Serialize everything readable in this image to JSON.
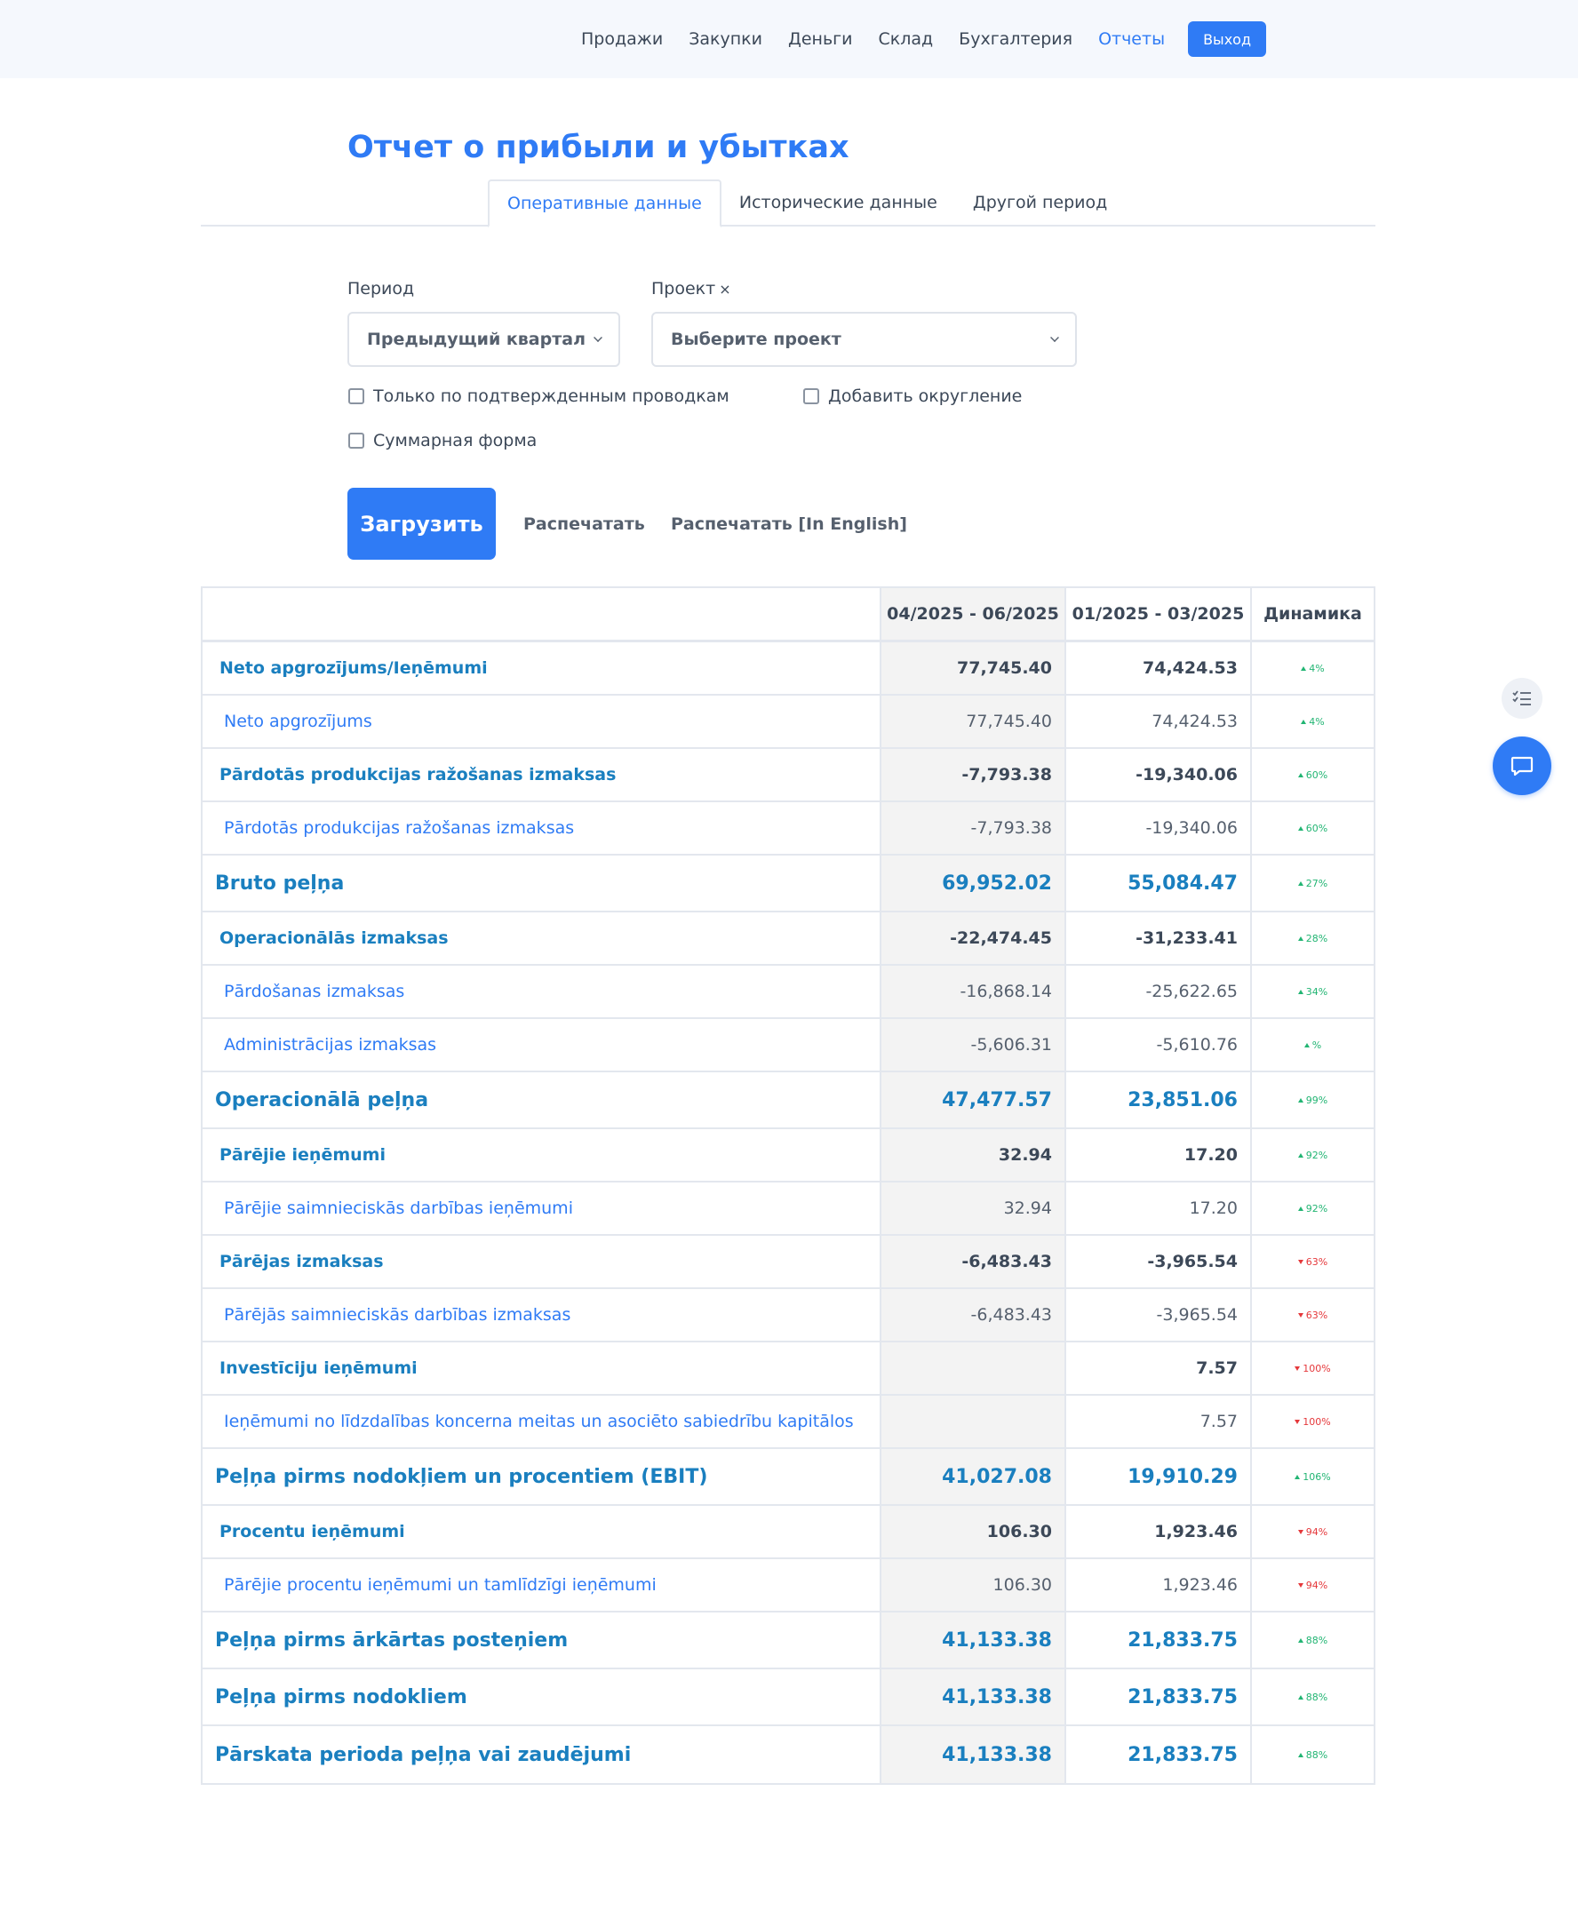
{
  "nav": {
    "items": [
      {
        "label": "Продажи",
        "active": false
      },
      {
        "label": "Закупки",
        "active": false
      },
      {
        "label": "Деньги",
        "active": false
      },
      {
        "label": "Склад",
        "active": false
      },
      {
        "label": "Бухгалтерия",
        "active": false
      },
      {
        "label": "Отчеты",
        "active": true
      }
    ],
    "logout_label": "Выход"
  },
  "page": {
    "title": "Отчет о прибыли и убытках"
  },
  "tabs": [
    {
      "label": "Оперативные данные",
      "active": true
    },
    {
      "label": "Исторические данные",
      "active": false
    },
    {
      "label": "Другой период",
      "active": false
    }
  ],
  "form": {
    "period_label": "Период",
    "period_value": "Предыдущий квартал",
    "project_label": "Проект",
    "project_clear": "×",
    "project_value": "Выберите проект",
    "checkbox_confirmed": "Только по подтвержденным проводкам",
    "checkbox_rounding": "Добавить округление",
    "checkbox_summary": "Суммарная форма",
    "load_button": "Загрузить",
    "print_button": "Распечатать",
    "print_en_button": "Распечатать [In English]"
  },
  "table": {
    "headers": [
      "",
      "04/2025 - 06/2025",
      "01/2025 - 03/2025",
      "Динамика"
    ],
    "rows": [
      {
        "type": "section",
        "label": "Neto apgrozījums/Ieņēmumi",
        "cur": "77,745.40",
        "prev": "74,424.53",
        "dyn": "4%",
        "dir": "up"
      },
      {
        "type": "item",
        "label": "Neto apgrozījums",
        "cur": "77,745.40",
        "prev": "74,424.53",
        "dyn": "4%",
        "dir": "up"
      },
      {
        "type": "section",
        "label": "Pārdotās produkcijas ražošanas izmaksas",
        "cur": "-7,793.38",
        "prev": "-19,340.06",
        "dyn": "60%",
        "dir": "up"
      },
      {
        "type": "item",
        "label": "Pārdotās produkcijas ražošanas izmaksas",
        "cur": "-7,793.38",
        "prev": "-19,340.06",
        "dyn": "60%",
        "dir": "up"
      },
      {
        "type": "total",
        "label": "Bruto peļņa",
        "cur": "69,952.02",
        "prev": "55,084.47",
        "dyn": "27%",
        "dir": "up"
      },
      {
        "type": "section",
        "label": "Operacionālās izmaksas",
        "cur": "-22,474.45",
        "prev": "-31,233.41",
        "dyn": "28%",
        "dir": "up"
      },
      {
        "type": "item",
        "label": "Pārdošanas izmaksas",
        "cur": "-16,868.14",
        "prev": "-25,622.65",
        "dyn": "34%",
        "dir": "up"
      },
      {
        "type": "item",
        "label": "Administrācijas izmaksas",
        "cur": "-5,606.31",
        "prev": "-5,610.76",
        "dyn": "%",
        "dir": "up"
      },
      {
        "type": "total",
        "label": "Operacionālā peļņa",
        "cur": "47,477.57",
        "prev": "23,851.06",
        "dyn": "99%",
        "dir": "up"
      },
      {
        "type": "section",
        "label": "Pārējie ieņēmumi",
        "cur": "32.94",
        "prev": "17.20",
        "dyn": "92%",
        "dir": "up"
      },
      {
        "type": "item",
        "label": "Pārējie saimnieciskās darbības ieņēmumi",
        "cur": "32.94",
        "prev": "17.20",
        "dyn": "92%",
        "dir": "up"
      },
      {
        "type": "section",
        "label": "Pārējas izmaksas",
        "cur": "-6,483.43",
        "prev": "-3,965.54",
        "dyn": "63%",
        "dir": "down"
      },
      {
        "type": "item",
        "label": "Pārējās saimnieciskās darbības izmaksas",
        "cur": "-6,483.43",
        "prev": "-3,965.54",
        "dyn": "63%",
        "dir": "down"
      },
      {
        "type": "section",
        "label": "Investīciju ieņēmumi",
        "cur": "",
        "prev": "7.57",
        "dyn": "100%",
        "dir": "down"
      },
      {
        "type": "item",
        "label": "Ieņēmumi no līdzdalības koncerna meitas un asociēto sabiedrību kapitālos",
        "cur": "",
        "prev": "7.57",
        "dyn": "100%",
        "dir": "down"
      },
      {
        "type": "total",
        "label": "Peļņa pirms nodokļiem un procentiem (EBIT)",
        "cur": "41,027.08",
        "prev": "19,910.29",
        "dyn": "106%",
        "dir": "up"
      },
      {
        "type": "section",
        "label": "Procentu ieņēmumi",
        "cur": "106.30",
        "prev": "1,923.46",
        "dyn": "94%",
        "dir": "down"
      },
      {
        "type": "item",
        "label": "Pārējie procentu ieņēmumi un tamlīdzīgi ieņēmumi",
        "cur": "106.30",
        "prev": "1,923.46",
        "dyn": "94%",
        "dir": "down"
      },
      {
        "type": "total",
        "label": "Peļņa pirms ārkārtas posteņiem",
        "cur": "41,133.38",
        "prev": "21,833.75",
        "dyn": "88%",
        "dir": "up"
      },
      {
        "type": "total",
        "label": "Peļņa pirms nodokliem",
        "cur": "41,133.38",
        "prev": "21,833.75",
        "dyn": "88%",
        "dir": "up"
      },
      {
        "type": "total",
        "label": "Pārskata perioda peļņa vai zaudējumi",
        "cur": "41,133.38",
        "prev": "21,833.75",
        "dyn": "88%",
        "dir": "up"
      }
    ]
  },
  "icons": {
    "checklist": "checklist-icon",
    "chat": "chat-icon",
    "chevron": "chevron-down-icon"
  },
  "colors": {
    "accent": "#2f7bf5",
    "label_blue": "#1a7fbf",
    "positive": "#22b573",
    "negative": "#e5383b"
  }
}
